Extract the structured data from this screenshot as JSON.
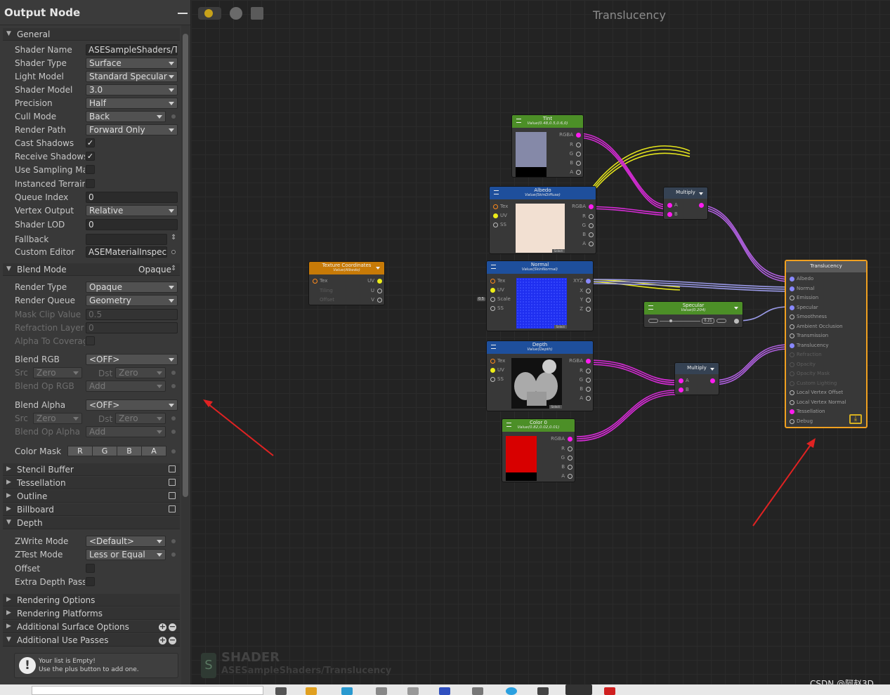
{
  "panel": {
    "title": "Output Node",
    "general": "General",
    "shader_name": {
      "label": "Shader Name",
      "value": "ASESampleShaders/Tra"
    },
    "shader_type": {
      "label": "Shader Type",
      "value": "Surface"
    },
    "light_model": {
      "label": "Light Model",
      "value": "Standard Specular"
    },
    "shader_model": {
      "label": "Shader Model",
      "value": "3.0"
    },
    "precision": {
      "label": "Precision",
      "value": "Half"
    },
    "cull_mode": {
      "label": "Cull Mode",
      "value": "Back"
    },
    "render_path": {
      "label": "Render Path",
      "value": "Forward Only"
    },
    "cast_shadows": {
      "label": "Cast Shadows",
      "check": "✓"
    },
    "receive_shadows": {
      "label": "Receive Shadows",
      "check": "✓"
    },
    "use_sampling": {
      "label": "Use Sampling Mac"
    },
    "instanced_terrain": {
      "label": "Instanced Terrain"
    },
    "queue_index": {
      "label": "Queue Index",
      "value": "0"
    },
    "vertex_output": {
      "label": "Vertex Output",
      "value": "Relative"
    },
    "shader_lod": {
      "label": "Shader LOD",
      "value": "0"
    },
    "fallback": {
      "label": "Fallback",
      "value": ""
    },
    "custom_editor": {
      "label": "Custom Editor",
      "value": "ASEMaterialInspecto"
    },
    "blend_mode": {
      "label": "Blend Mode",
      "value": "Opaque"
    },
    "render_type": {
      "label": "Render Type",
      "value": "Opaque"
    },
    "render_queue": {
      "label": "Render Queue",
      "value": "Geometry"
    },
    "mask_clip": {
      "label": "Mask Clip Value",
      "value": "0.5"
    },
    "refraction_layer": {
      "label": "Refraction Layer",
      "value": "0"
    },
    "alpha_coverage": {
      "label": "Alpha To Coverage"
    },
    "blend_rgb": {
      "label": "Blend RGB",
      "value": "<OFF>"
    },
    "src_rgb": {
      "label": "Src",
      "value": "Zero"
    },
    "dst_rgb": {
      "label": "Dst",
      "value": "Zero"
    },
    "blend_op_rgb": {
      "label": "Blend Op RGB",
      "value": "Add"
    },
    "blend_alpha": {
      "label": "Blend Alpha",
      "value": "<OFF>"
    },
    "src_alpha": {
      "label": "Src",
      "value": "Zero"
    },
    "dst_alpha": {
      "label": "Dst",
      "value": "Zero"
    },
    "blend_op_alpha": {
      "label": "Blend Op Alpha",
      "value": "Add"
    },
    "color_mask": {
      "label": "Color Mask",
      "r": "R",
      "g": "G",
      "b": "B",
      "a": "A"
    },
    "stencil_buffer": "Stencil Buffer",
    "tessellation": "Tessellation",
    "outline": "Outline",
    "billboard": "Billboard",
    "depth": "Depth",
    "zwrite": {
      "label": "ZWrite Mode",
      "value": "<Default>"
    },
    "ztest": {
      "label": "ZTest Mode",
      "value": "Less or Equal"
    },
    "offset": {
      "label": "Offset"
    },
    "extra_depth": {
      "label": "Extra Depth Pass"
    },
    "rendering_options": "Rendering Options",
    "rendering_platforms": "Rendering Platforms",
    "additional_surface": "Additional Surface Options",
    "additional_passes": "Additional Use Passes",
    "empty_line1": "Your list is Empty!",
    "empty_line2": "Use the plus button to add one."
  },
  "canvas": {
    "title": "Translucency",
    "watermark_title": "SHADER",
    "watermark_path": "ASESampleShaders/Translucency"
  },
  "nodes": {
    "tint": {
      "title": "Tint",
      "value": "Value(0.48,0.5,0.6,0)",
      "ports": [
        "RGBA",
        "R",
        "G",
        "B",
        "A"
      ],
      "swatch": "#8589a8"
    },
    "albedo": {
      "title": "Albedo",
      "value": "Value(SkinDiffuse)",
      "in": [
        "Tex",
        "UV",
        "SS"
      ],
      "out": [
        "RGBA",
        "R",
        "G",
        "B",
        "A"
      ],
      "select": "Select"
    },
    "texcoord": {
      "title": "Texture Coordinates",
      "value": "Value(Albedo)",
      "in": [
        "Tex",
        "Tiling",
        "Offset"
      ],
      "out": [
        "UV",
        "U",
        "V"
      ],
      "badge": "0.5"
    },
    "normal": {
      "title": "Normal",
      "value": "Value(SkinNormal)",
      "in": [
        "Tex",
        "UV",
        "Scale",
        "SS"
      ],
      "out": [
        "XYZ",
        "X",
        "Y",
        "Z"
      ],
      "select": "Select"
    },
    "multiply1": {
      "title": "Multiply",
      "in": [
        "A",
        "B"
      ]
    },
    "specular": {
      "title": "Specular",
      "value": "Value(0.204)",
      "num": "0.21"
    },
    "depth": {
      "title": "Depth",
      "value": "Value(Depth)",
      "in": [
        "Tex",
        "UV",
        "SS"
      ],
      "out": [
        "RGBA",
        "R",
        "G",
        "B",
        "A"
      ],
      "select": "Select"
    },
    "multiply2": {
      "title": "Multiply",
      "in": [
        "A",
        "B"
      ]
    },
    "color0": {
      "title": "Color 0",
      "value": "Value(0.82,0.02,0.01)",
      "ports": [
        "RGBA",
        "R",
        "G",
        "B",
        "A"
      ],
      "swatch": "#d80000"
    },
    "output": {
      "title": "Translucency",
      "inputs": [
        "Albedo",
        "Normal",
        "Emission",
        "Specular",
        "Smoothness",
        "Ambient Occlusion",
        "Transmission",
        "Translucency",
        "Refraction",
        "Opacity",
        "Opacity Mask",
        "Custom Lighting",
        "Local Vertex Offset",
        "Local Vertex Normal",
        "Tessellation",
        "Debug"
      ]
    }
  },
  "colors": {
    "accent": "#f0a020",
    "wire_pink": "#d42bd4",
    "wire_yellow": "#dede20",
    "wire_blue": "#8a8ad8",
    "arrow": "#e02020"
  },
  "footer": {
    "credit": "CSDN @阿赵3D"
  }
}
